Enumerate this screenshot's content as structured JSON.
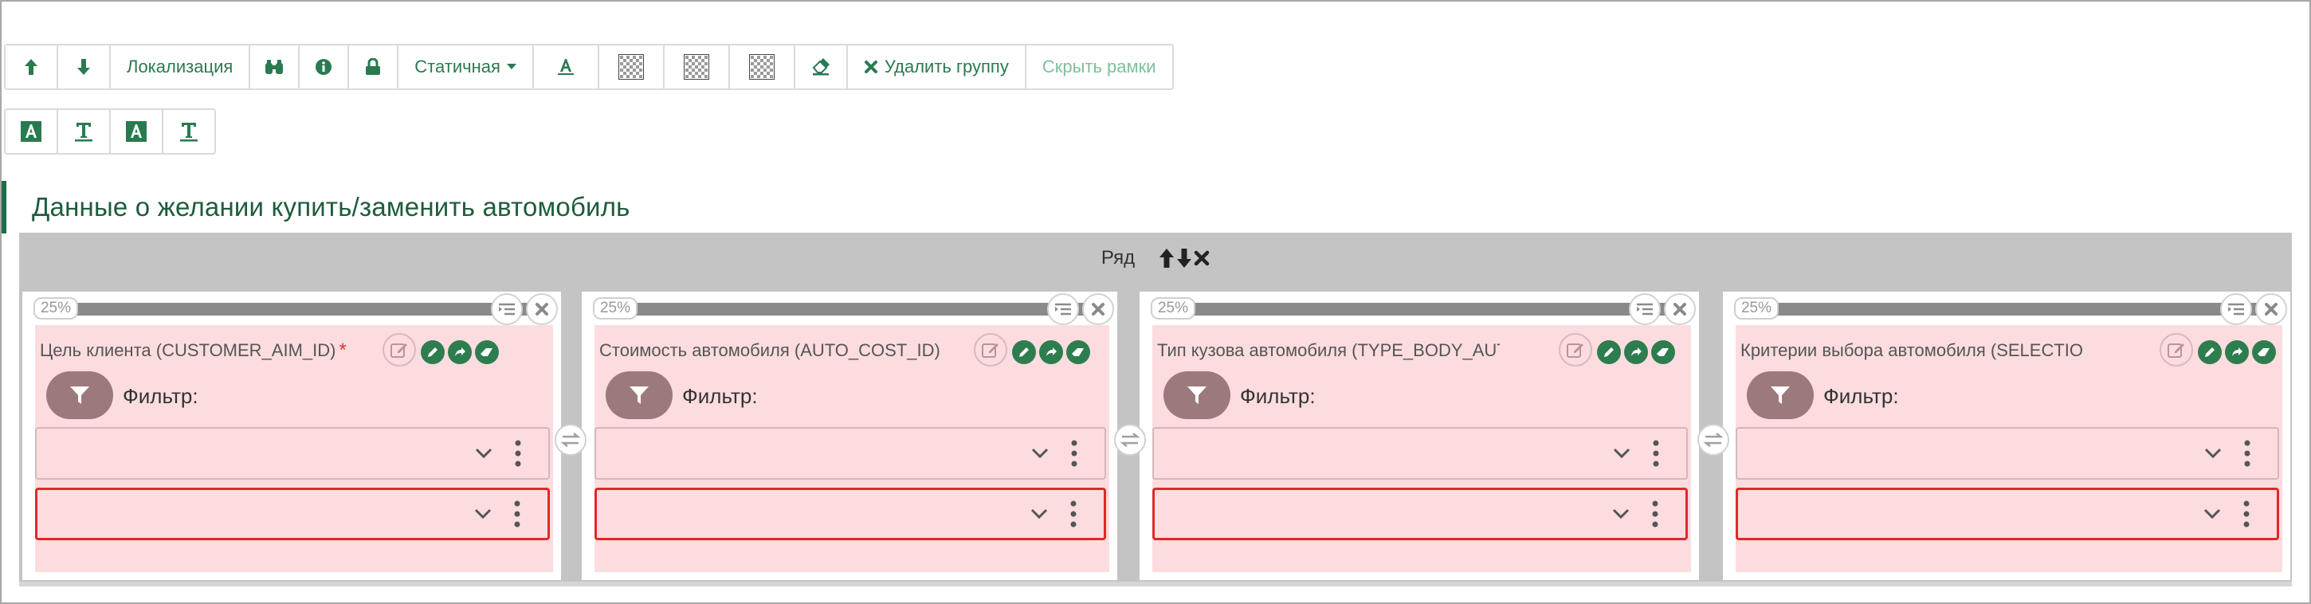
{
  "toolbar": {
    "localization_label": "Локализация",
    "static_label": "Статичная",
    "delete_group_label": "Удалить группу",
    "hide_frames_label": "Скрыть рамки"
  },
  "section": {
    "title": "Данные о желании купить/заменить автомобиль"
  },
  "row": {
    "label": "Ряд"
  },
  "columns": [
    {
      "percent": "25%",
      "field_label": "Цель клиента (CUSTOMER_AIM_ID)",
      "required": "*",
      "filter_label": "Фильтр:"
    },
    {
      "percent": "25%",
      "field_label": "Стоимость автомобиля (AUTO_COST_ID)",
      "required": "*",
      "filter_label": "Фильтр:"
    },
    {
      "percent": "25%",
      "field_label": "Тип кузова автомобиля (TYPE_BODY_AUTO_...",
      "required": "",
      "filter_label": "Фильтр:"
    },
    {
      "percent": "25%",
      "field_label": "Критерии выбора автомобиля (SELECTION_...",
      "required": "",
      "filter_label": "Фильтр:"
    }
  ],
  "colors": {
    "accent_green": "#2e7d4f",
    "field_bg": "#fcdcdf",
    "required_red": "#e0323c",
    "error_border": "#e02828",
    "row_gray": "#c4c4c4"
  },
  "icons": [
    "arrow-up-icon",
    "arrow-down-icon",
    "binoculars-icon",
    "info-icon",
    "lock-icon",
    "text-color-icon",
    "transparency-icon",
    "eraser-icon",
    "close-icon",
    "text-bg-icon",
    "text-underline-icon",
    "list-icon",
    "edit-icon",
    "pencil-icon",
    "share-icon",
    "filter-icon",
    "chevron-down-icon",
    "more-vertical-icon",
    "swap-icon"
  ]
}
